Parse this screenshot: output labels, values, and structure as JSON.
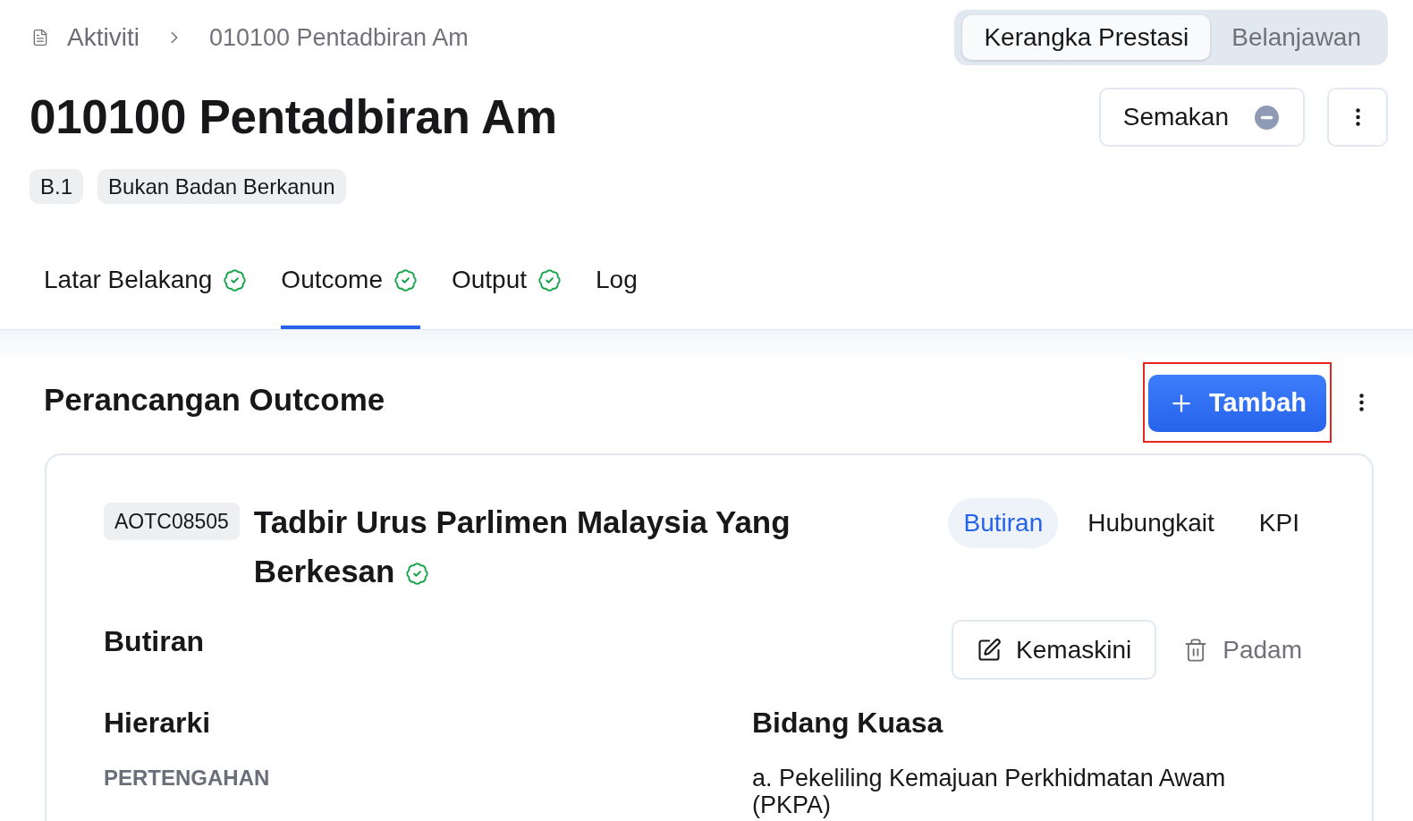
{
  "breadcrumb": [
    "Aktiviti",
    "010100 Pentadbiran Am"
  ],
  "view_switch": [
    {
      "label": "Kerangka Prestasi",
      "selected": true
    },
    {
      "label": "Belanjawan",
      "selected": false
    }
  ],
  "page": {
    "title": "010100 Pentadbiran Am",
    "tags": [
      "B.1",
      "Bukan Badan Berkanun"
    ],
    "status_button": {
      "label": "Semakan"
    }
  },
  "tabs": [
    {
      "label": "Latar Belakang",
      "selected": false,
      "verified": true
    },
    {
      "label": "Outcome",
      "selected": true,
      "verified": true
    },
    {
      "label": "Output",
      "selected": false,
      "verified": true
    },
    {
      "label": "Log",
      "selected": false,
      "verified": false
    }
  ],
  "section": {
    "title": "Perancangan Outcome",
    "add_button": {
      "label": "Tambah",
      "highlighted": true
    }
  },
  "outcome_card": {
    "code": "AOTC08505",
    "title": "Tadbir Urus Parlimen Malaysia Yang Berkesan",
    "verified": true,
    "tabs": [
      {
        "label": "Butiran",
        "selected": true
      },
      {
        "label": "Hubungkait",
        "selected": false
      },
      {
        "label": "KPI",
        "selected": false
      }
    ],
    "details_heading": "Butiran",
    "actions": [
      {
        "label": "Kemaskini",
        "kind": "edit"
      },
      {
        "label": "Padam",
        "kind": "delete"
      }
    ],
    "fields": [
      {
        "heading": "Hierarki",
        "value": "PERTENGAHAN",
        "kind": "level"
      },
      {
        "heading": "Bidang Kuasa",
        "value": "a. Pekeliling Kemajuan Perkhidmatan Awam (PKPA)",
        "kind": "text"
      }
    ]
  }
}
